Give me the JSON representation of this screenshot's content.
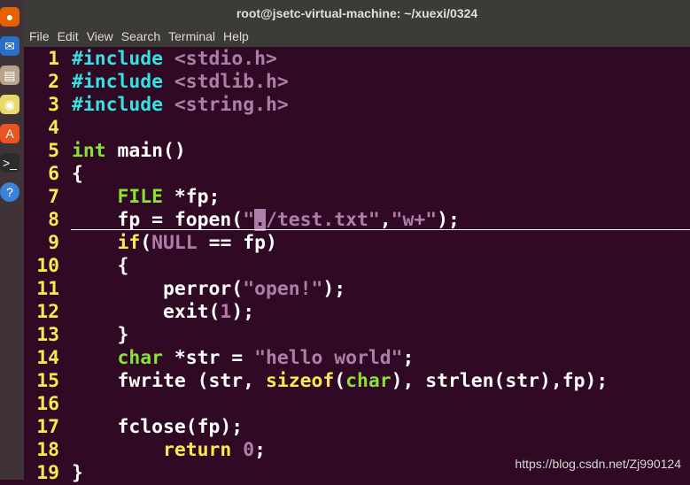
{
  "window": {
    "title": "root@jsetc-virtual-machine: ~/xuexi/0324"
  },
  "menu": [
    "File",
    "Edit",
    "View",
    "Search",
    "Terminal",
    "Help"
  ],
  "launcher": [
    {
      "icon": "firefox-icon",
      "color": "#e66000"
    },
    {
      "icon": "thunderbird-icon",
      "color": "#2a6ec8"
    },
    {
      "icon": "files-icon",
      "color": "#b7a48c"
    },
    {
      "icon": "rhythmbox-icon",
      "color": "#e8d96b"
    },
    {
      "icon": "software-center-icon",
      "color": "#e95420"
    },
    {
      "icon": "terminal-icon",
      "color": "#2c2c2c"
    },
    {
      "icon": "help-icon",
      "color": "#3a83d6"
    }
  ],
  "colors": {
    "background": "#300a24",
    "line_number": "#fce94f",
    "preprocessor": "#34e2e2",
    "string": "#ad7fa8",
    "keyword": "#fce94f",
    "type": "#8ae234"
  },
  "code": [
    [
      [
        "#include",
        "p"
      ],
      [
        " "
      ],
      [
        "<stdio.h>",
        "s"
      ]
    ],
    [
      [
        "#include",
        "p"
      ],
      [
        " "
      ],
      [
        "<stdlib.h>",
        "s"
      ]
    ],
    [
      [
        "#include",
        "p"
      ],
      [
        " "
      ],
      [
        "<string.h>",
        "s"
      ]
    ],
    [],
    [
      [
        "int",
        "ty"
      ],
      [
        " main()"
      ]
    ],
    [
      [
        "{"
      ]
    ],
    [
      [
        "    "
      ],
      [
        "FILE",
        "ty"
      ],
      [
        " *fp;"
      ]
    ],
    [
      [
        "    fp = fopen("
      ],
      [
        "\"",
        "s"
      ],
      [
        ".",
        "cur"
      ],
      [
        "/test.txt\"",
        "s"
      ],
      [
        ","
      ],
      [
        "\"w+\"",
        "s"
      ],
      [
        ");"
      ]
    ],
    [
      [
        "    "
      ],
      [
        "if",
        "k"
      ],
      [
        "("
      ],
      [
        "NULL",
        "s"
      ],
      [
        " == fp)"
      ]
    ],
    [
      [
        "    {"
      ]
    ],
    [
      [
        "        perror("
      ],
      [
        "\"open!\"",
        "s"
      ],
      [
        ");"
      ]
    ],
    [
      [
        "        exit("
      ],
      [
        "1",
        "s"
      ],
      [
        ");"
      ]
    ],
    [
      [
        "    }"
      ]
    ],
    [
      [
        "    "
      ],
      [
        "char",
        "ty"
      ],
      [
        " *str = "
      ],
      [
        "\"hello world\"",
        "s"
      ],
      [
        ";"
      ]
    ],
    [
      [
        "    fwrite (str, "
      ],
      [
        "sizeof",
        "k"
      ],
      [
        "("
      ],
      [
        "char",
        "ty"
      ],
      [
        "), strlen(str),fp);"
      ]
    ],
    [],
    [
      [
        "    fclose(fp);"
      ]
    ],
    [
      [
        "        "
      ],
      [
        "return",
        "k"
      ],
      [
        " "
      ],
      [
        "0",
        "s"
      ],
      [
        ";"
      ]
    ],
    [
      [
        "}"
      ]
    ]
  ],
  "cursor_line": 8,
  "watermark": "https://blog.csdn.net/Zj990124"
}
